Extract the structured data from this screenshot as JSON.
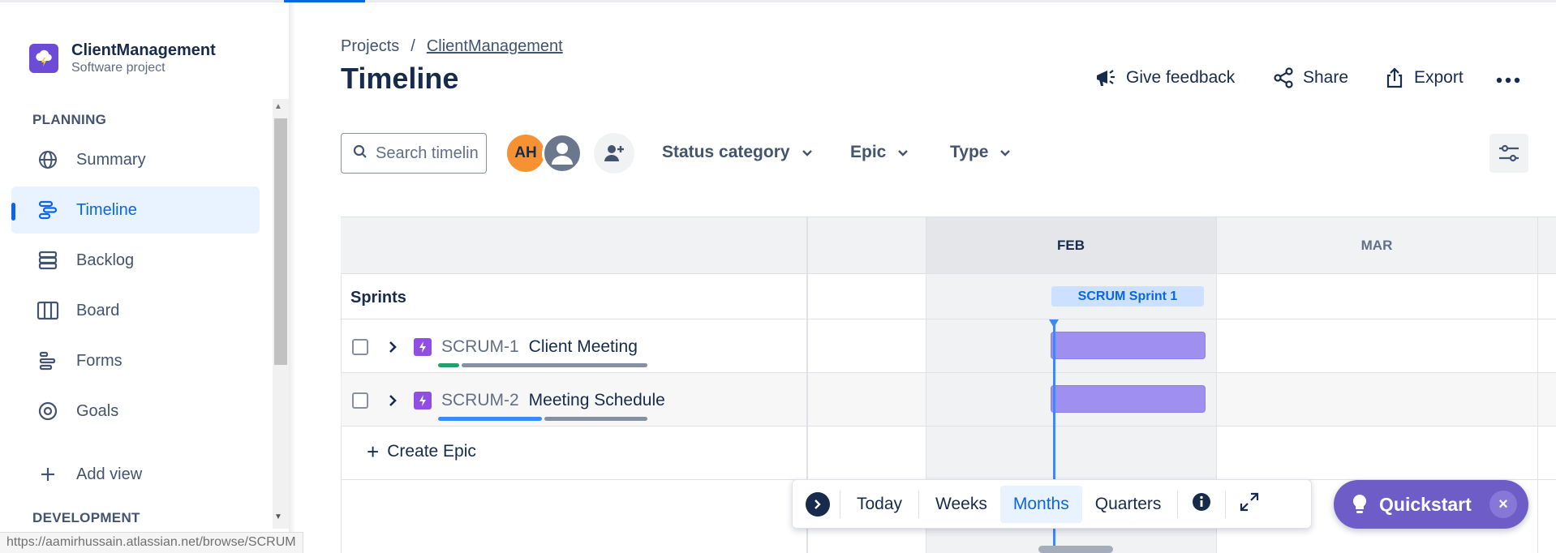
{
  "sidebar": {
    "project_name": "ClientManagement",
    "project_type": "Software project",
    "planning_title": "PLANNING",
    "development_title": "DEVELOPMENT",
    "items": [
      {
        "label": "Summary",
        "icon": "globe-icon"
      },
      {
        "label": "Timeline",
        "icon": "timeline-icon"
      },
      {
        "label": "Backlog",
        "icon": "backlog-icon"
      },
      {
        "label": "Board",
        "icon": "board-icon"
      },
      {
        "label": "Forms",
        "icon": "forms-icon"
      },
      {
        "label": "Goals",
        "icon": "goals-icon"
      }
    ],
    "add_view": "Add view"
  },
  "header": {
    "breadcrumb_root": "Projects",
    "breadcrumb_sep": "/",
    "breadcrumb_project": "ClientManagement",
    "title": "Timeline",
    "feedback": "Give feedback",
    "share": "Share",
    "export": "Export"
  },
  "filters": {
    "search_placeholder": "Search timeline",
    "avatar_initials": "AH",
    "status_category": "Status category",
    "epic": "Epic",
    "type": "Type"
  },
  "timeline": {
    "months": [
      "FEB",
      "MAR"
    ],
    "sprints_label": "Sprints",
    "sprint_name": "SCRUM Sprint 1",
    "epics": [
      {
        "key": "SCRUM-1",
        "title": "Client Meeting"
      },
      {
        "key": "SCRUM-2",
        "title": "Meeting Schedule"
      }
    ],
    "create_epic": "Create Epic"
  },
  "view_switcher": {
    "today": "Today",
    "weeks": "Weeks",
    "months": "Months",
    "quarters": "Quarters",
    "selected": "Months"
  },
  "quickstart": {
    "label": "Quickstart",
    "close": "×"
  },
  "status_bar_url": "https://aamirhussain.atlassian.net/browse/SCRUM",
  "colors": {
    "accent": "#0c66e4",
    "epic_bar": "#9f8fef",
    "epic_icon": "#904ee2",
    "quickstart": "#6e5dc6",
    "avatar_ah": "#f79232"
  }
}
